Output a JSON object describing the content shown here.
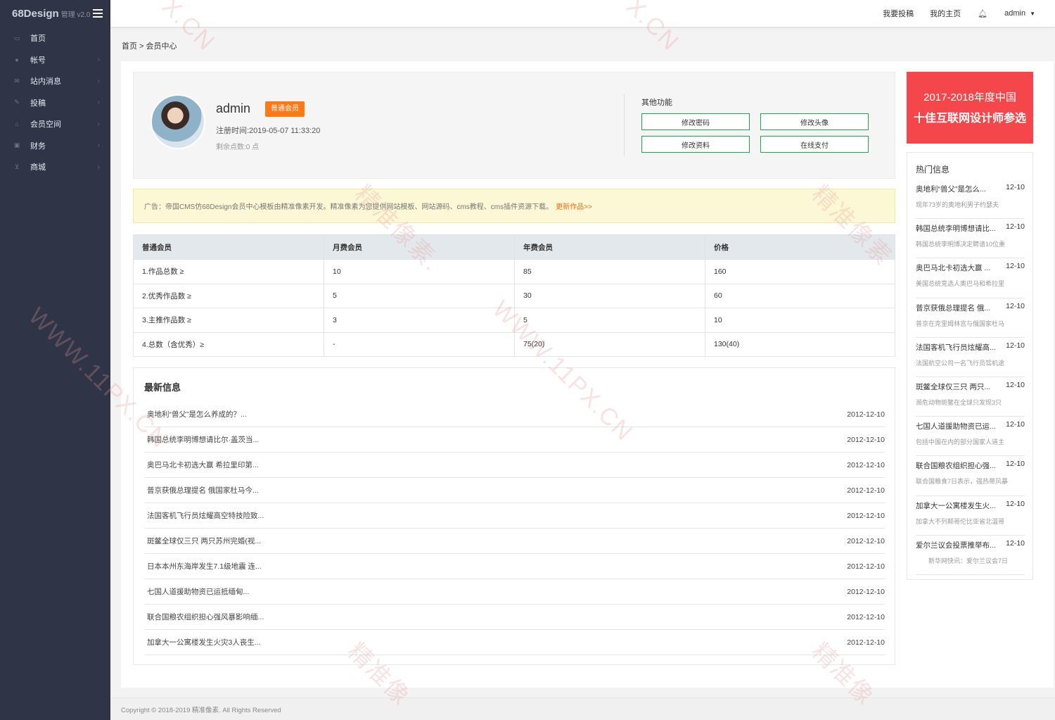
{
  "sidebar": {
    "brand": "68Design",
    "brand_suffix": "管理 v2.0",
    "items": [
      {
        "label": "首页",
        "icon": "monitor-icon",
        "glyph": "▭"
      },
      {
        "label": "帐号",
        "icon": "user-icon",
        "glyph": "●"
      },
      {
        "label": "站内消息",
        "icon": "mail-icon",
        "glyph": "✉"
      },
      {
        "label": "投稿",
        "icon": "edit-icon",
        "glyph": "✎"
      },
      {
        "label": "会员空间",
        "icon": "home-icon",
        "glyph": "⌂"
      },
      {
        "label": "财务",
        "icon": "card-icon",
        "glyph": "▣"
      },
      {
        "label": "商城",
        "icon": "cart-icon",
        "glyph": "⊻"
      }
    ]
  },
  "topbar": {
    "link1": "我要投稿",
    "link2": "我的主页",
    "user": "admin"
  },
  "breadcrumb": "首页 > 会员中心",
  "profile": {
    "name": "admin",
    "level": "普通会员",
    "reg_time": "注册时间:2019-05-07 11:33:20",
    "points": "剩余点数:0 点",
    "other_title": "其他功能",
    "buttons": [
      "修改密码",
      "修改头像",
      "修改资料",
      "在线支付"
    ]
  },
  "ad": {
    "text": "广告：帝国CMS仿68Design会员中心模板由精准像素开发。精准像素为您提供网站模板、网站源码、cms教程、cms插件资源下载。",
    "link": "更新作品>>"
  },
  "levels_table": {
    "headers": [
      "普通会员",
      "月费会员",
      "年费会员",
      "价格"
    ],
    "rows": [
      [
        "1.作品总数 ≥",
        "10",
        "85",
        "160"
      ],
      [
        "2.优秀作品数 ≥",
        "5",
        "30",
        "60"
      ],
      [
        "3.主推作品数 ≥",
        "3",
        "5",
        "10"
      ],
      [
        "4.总数（含优秀）≥",
        "-",
        "75(20)",
        "130(40)"
      ]
    ]
  },
  "news": {
    "title": "最新信息",
    "items": [
      {
        "title": "奥地利“兽父”是怎么养成的？...",
        "date": "2012-12-10"
      },
      {
        "title": "韩国总统李明博想请比尔·盖茨当...",
        "date": "2012-12-10"
      },
      {
        "title": "奥巴马北卡初选大赢 希拉里印第...",
        "date": "2012-12-10"
      },
      {
        "title": "普京获俄总理提名 俄国家杜马今...",
        "date": "2012-12-10"
      },
      {
        "title": "法国客机飞行员炫耀高空特技险致...",
        "date": "2012-12-10"
      },
      {
        "title": "斑鳖全球仅三只 两只苏州完婚(视...",
        "date": "2012-12-10"
      },
      {
        "title": "日本本州东海岸发生7.1级地震 连...",
        "date": "2012-12-10"
      },
      {
        "title": "七国人道援助物资已运抵缅甸...",
        "date": "2012-12-10"
      },
      {
        "title": "联合国粮农组织担心强风暴影响缅...",
        "date": "2012-12-10"
      },
      {
        "title": "加拿大一公寓楼发生火灾3人丧生...",
        "date": "2012-12-10"
      }
    ]
  },
  "promo": {
    "line1": "2017-2018年度中国",
    "line2": "十佳互联网设计师参选"
  },
  "hot": {
    "title": "热门信息",
    "items": [
      {
        "title": "奥地利“兽父”是怎么...",
        "date": "12-10",
        "summary": "现年73岁的奥地利男子约瑟夫"
      },
      {
        "title": "韩国总统李明博想请比...",
        "date": "12-10",
        "summary": "韩国总统李明博决定聘请10位重"
      },
      {
        "title": "奥巴马北卡初选大赢 ...",
        "date": "12-10",
        "summary": "美国总统竞选人奥巴马和希拉里"
      },
      {
        "title": "普京获俄总理提名 俄...",
        "date": "12-10",
        "summary": "普京在克里姆林宫与俄国家杜马"
      },
      {
        "title": "法国客机飞行员炫耀高...",
        "date": "12-10",
        "summary": "法国航空公司一名飞行员驾机途"
      },
      {
        "title": "斑鳖全球仅三只 两只...",
        "date": "12-10",
        "summary": "濒危动物斑鳖在全球只发现3只"
      },
      {
        "title": "七国人道援助物资已运...",
        "date": "12-10",
        "summary": "包括中国在内的部分国家人道主"
      },
      {
        "title": "联合国粮农组织担心强...",
        "date": "12-10",
        "summary": "联合国粮食7日表示，强热带风暴"
      },
      {
        "title": "加拿大一公寓楼发生火...",
        "date": "12-10",
        "summary": "加拿大不列颠哥伦比亚省北温哥"
      },
      {
        "title": "爱尔兰议会投票推举布...",
        "date": "12-10",
        "summary": "新华网快讯：爱尔兰议会7日"
      }
    ]
  },
  "footer": "Copyright © 2018-2019 精准像素. All Rights Reserved",
  "watermarks": [
    "X.CN",
    "X.CN",
    "精准像素.",
    "WWW.11PX.CN",
    "WWW.11PX.CN",
    "精准像素",
    "精准像",
    "精准像"
  ],
  "colors": {
    "sidebar_bg": "#2f3447",
    "accent_orange": "#ff7a15",
    "button_border_green": "#24a34f",
    "promo_red": "#f5474b",
    "ad_bg": "#fcf8d6"
  }
}
